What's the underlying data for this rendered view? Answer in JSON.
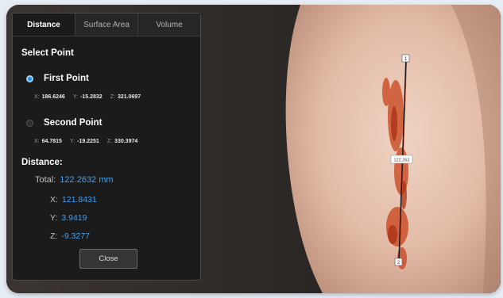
{
  "tabs": [
    {
      "label": "Distance"
    },
    {
      "label": "Surface Area"
    },
    {
      "label": "Volume"
    }
  ],
  "select_point": {
    "title": "Select Point",
    "first": {
      "label": "First Point",
      "x_label": "X:",
      "x": "186.6246",
      "y_label": "Y:",
      "y": "-15.2832",
      "z_label": "Z:",
      "z": "321.0697"
    },
    "second": {
      "label": "Second Point",
      "x_label": "X:",
      "x": "64.7815",
      "y_label": "Y:",
      "y": "-19.2251",
      "z_label": "Z:",
      "z": "330.3974"
    }
  },
  "distance": {
    "title": "Distance:",
    "total_label": "Total:",
    "total": "122.2632  mm",
    "x_label": "X:",
    "x": "121.8431",
    "y_label": "Y:",
    "y": "3.9419",
    "z_label": "Z:",
    "z": "-9.3277"
  },
  "close_label": "Close",
  "viewport": {
    "measure_badge": "122.263",
    "marker_top": "1",
    "marker_bottom": "2"
  },
  "colors": {
    "accent": "#1e90e8",
    "value_blue": "#3fa0f0",
    "measure_line": "#1a1a1a",
    "wound": "#c8421a"
  }
}
